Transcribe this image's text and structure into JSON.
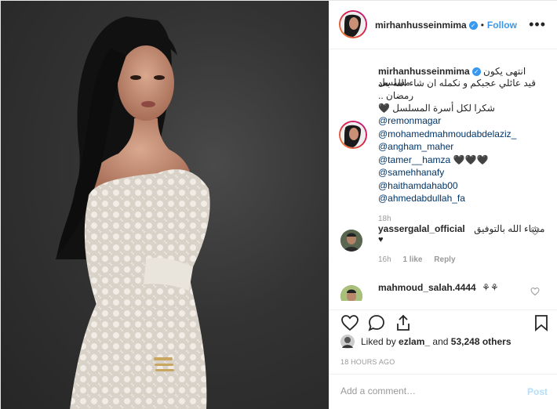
{
  "header": {
    "username": "mirhanhusseinmima",
    "separator": "•",
    "follow_label": "Follow",
    "more_label": "•••"
  },
  "caption": {
    "username": "mirhanhusseinmima",
    "line1": "انتهى يكون مسلسل",
    "line2": "قيد عائلي عجبكم و نكمله ان شاء الله بعد رمضان ..",
    "line3": "شكرا لكل أسرة المسلسل 🖤",
    "mentions": [
      "@remonmagar",
      "@mohamedmahmoudabdelaziz_",
      "@angham_maher",
      "@tamer__hamza",
      "@samehhanafy",
      "@haithamdahab00",
      "@ahmedabdullah_fa"
    ],
    "tamer_hearts": "🖤🖤🖤",
    "time": "18h"
  },
  "comments": [
    {
      "username": "yassergalal_official",
      "text": "مشاء الله بالتوفيق",
      "heart": "♥",
      "time": "16h",
      "likes": "1 like",
      "reply_label": "Reply"
    },
    {
      "username": "mahmoud_salah.4444",
      "text": "⚘⚘"
    }
  ],
  "likes": {
    "prefix": "Liked by",
    "user": "ezlam_",
    "and": "and",
    "count": "53,248 others"
  },
  "timestamp": "18 HOURS AGO",
  "add_comment": {
    "placeholder": "Add a comment…",
    "post_label": "Post"
  },
  "colors": {
    "accent": "#3897f0",
    "link": "#003569",
    "muted": "#999999",
    "post_disabled": "#b2dffc"
  },
  "icons": [
    "heart-icon",
    "comment-icon",
    "share-icon",
    "bookmark-icon",
    "verified-icon",
    "more-icon"
  ]
}
